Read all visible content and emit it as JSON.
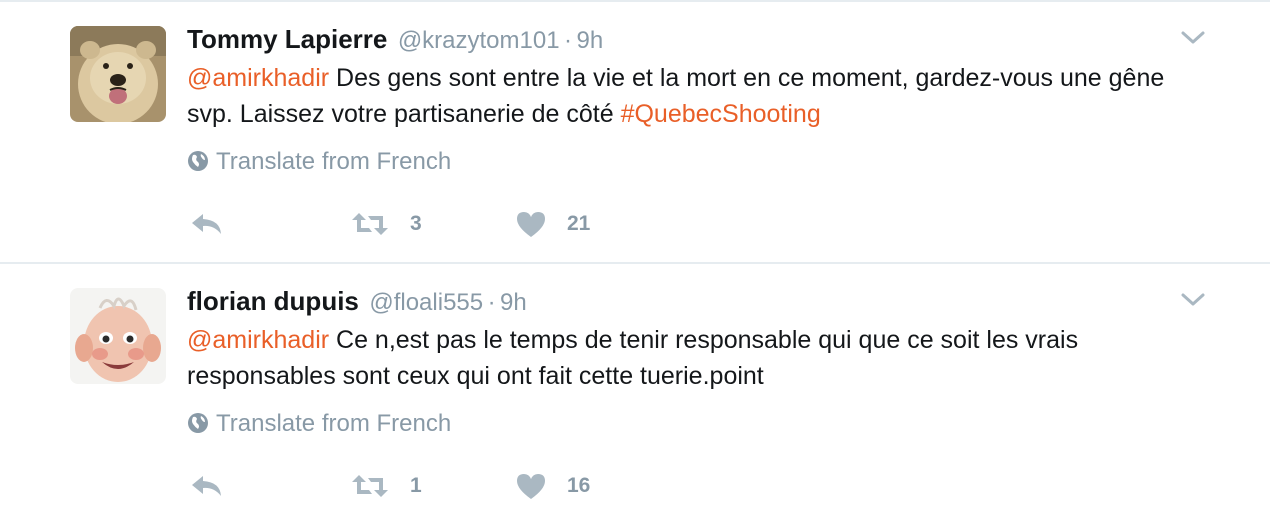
{
  "tweets": [
    {
      "fullname": "Tommy Lapierre",
      "username": "@krazytom101",
      "separator": "·",
      "time": "9h",
      "mention": "@amirkhadir",
      "text": " Des gens sont entre la vie et la mort en ce moment, gardez-vous une gêne svp. Laissez votre partisanerie de côté ",
      "hashtag": "#QuebecShooting",
      "translate_label": "Translate from French",
      "retweet_count": "3",
      "like_count": "21",
      "avatar_icon": "polar-bear-avatar"
    },
    {
      "fullname": "florian dupuis",
      "username": "@floali555",
      "separator": "·",
      "time": "9h",
      "mention": "@amirkhadir",
      "text": " Ce n,est pas le temps de tenir responsable qui que ce soit les vrais responsables sont ceux qui ont fait cette tuerie.point",
      "hashtag": "",
      "translate_label": "Translate from French",
      "retweet_count": "1",
      "like_count": "16",
      "avatar_icon": "baby-face-avatar"
    }
  ],
  "colors": {
    "accent": "#e95f28",
    "muted": "#8899a6",
    "text": "#14171a",
    "icon": "#aab8c2",
    "border": "#e6ecf0"
  }
}
